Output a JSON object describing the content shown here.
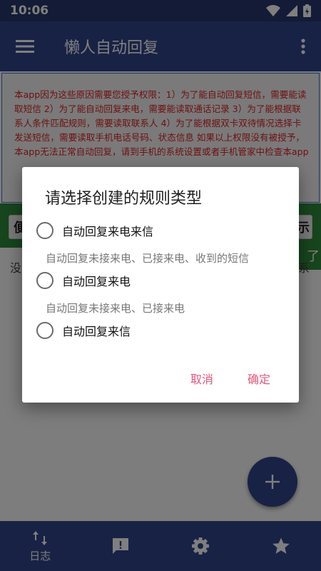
{
  "status_bar": {
    "time": "10:06"
  },
  "app_bar": {
    "title": "懒人自动回复"
  },
  "notice": {
    "text": "本app因为这些原因需要您授予权限：1）为了能自动回复短信，需要能读取短信 2）为了能自动回复来电，需要能读取通话记录 3）为了能根据联系人条件匹配规则，需要读取联系人 4）为了能根据双卡双待情况选择卡发送短信，需要读取手机电话号码、状态信息 如果以上权限没有被授予，本app无法正常自动回复，请到手机的系统设置或者手机管家中检查本app",
    "grant_fragment": "了"
  },
  "rules_row": {
    "left_fragment": "便",
    "right_fragment": "示"
  },
  "empty": {
    "left_fragment": "没",
    "right_fragment": "系"
  },
  "fab": {
    "icon": "plus-icon"
  },
  "bottom_nav": {
    "items": [
      {
        "icon": "swap-vertical-icon",
        "label": "日志"
      },
      {
        "icon": "feedback-icon",
        "label": ""
      },
      {
        "icon": "gear-icon",
        "label": ""
      },
      {
        "icon": "star-icon",
        "label": ""
      }
    ]
  },
  "dialog": {
    "title": "请选择创建的规则类型",
    "options": [
      {
        "label": "自动回复来电来信",
        "description": "自动回复未接来电、已接来电、收到的短信",
        "selected": false
      },
      {
        "label": "自动回复来电",
        "description": "自动回复未接来电、已接来电",
        "selected": false
      },
      {
        "label": "自动回复来信",
        "description": "",
        "selected": false
      }
    ],
    "cancel_label": "取消",
    "confirm_label": "确定"
  },
  "colors": {
    "primary": "#30448a",
    "status_bar": "#27376d",
    "accent": "#e5577a",
    "notice_text": "#e02020",
    "green": "#2f8a3a"
  }
}
